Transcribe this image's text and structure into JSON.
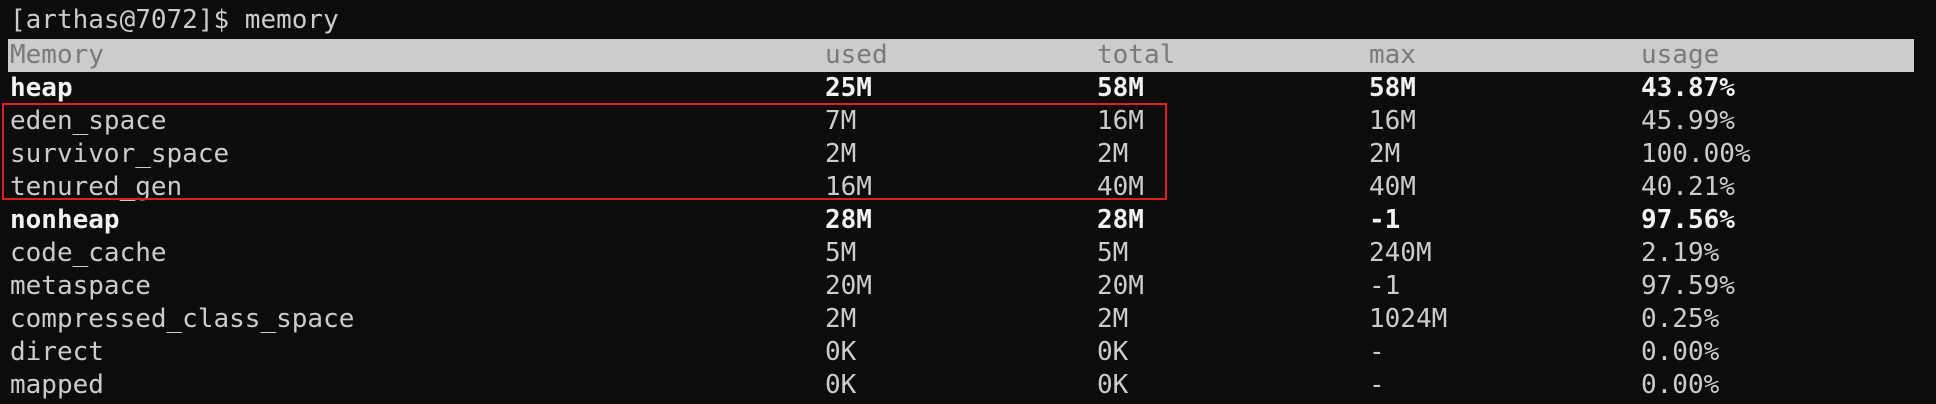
{
  "prompt": "[arthas@7072]$ memory",
  "headers": [
    "Memory",
    "used",
    "total",
    "max",
    "usage"
  ],
  "rows": [
    {
      "name": "heap",
      "used": "25M",
      "total": "58M",
      "max": "58M",
      "usage": "43.87%",
      "bold": true
    },
    {
      "name": "eden_space",
      "used": "7M",
      "total": "16M",
      "max": "16M",
      "usage": "45.99%",
      "bold": false
    },
    {
      "name": "survivor_space",
      "used": "2M",
      "total": "2M",
      "max": "2M",
      "usage": "100.00%",
      "bold": false
    },
    {
      "name": "tenured_gen",
      "used": "16M",
      "total": "40M",
      "max": "40M",
      "usage": "40.21%",
      "bold": false
    },
    {
      "name": "nonheap",
      "used": "28M",
      "total": "28M",
      "max": "-1",
      "usage": "97.56%",
      "bold": true
    },
    {
      "name": "code_cache",
      "used": "5M",
      "total": "5M",
      "max": "240M",
      "usage": "2.19%",
      "bold": false
    },
    {
      "name": "metaspace",
      "used": "20M",
      "total": "20M",
      "max": "-1",
      "usage": "97.59%",
      "bold": false
    },
    {
      "name": "compressed_class_space",
      "used": "2M",
      "total": "2M",
      "max": "1024M",
      "usage": "0.25%",
      "bold": false
    },
    {
      "name": "direct",
      "used": "0K",
      "total": "0K",
      "max": "-",
      "usage": "0.00%",
      "bold": false
    },
    {
      "name": "mapped",
      "used": "0K",
      "total": "0K",
      "max": "-",
      "usage": "0.00%",
      "bold": false
    }
  ],
  "colors": {
    "background": "#0c0c0c",
    "text": "#cccccc",
    "bold_text": "#f2f2f2",
    "header_bg": "#cccccc",
    "header_text": "#7a7a7a",
    "highlight_border": "#e02020"
  }
}
